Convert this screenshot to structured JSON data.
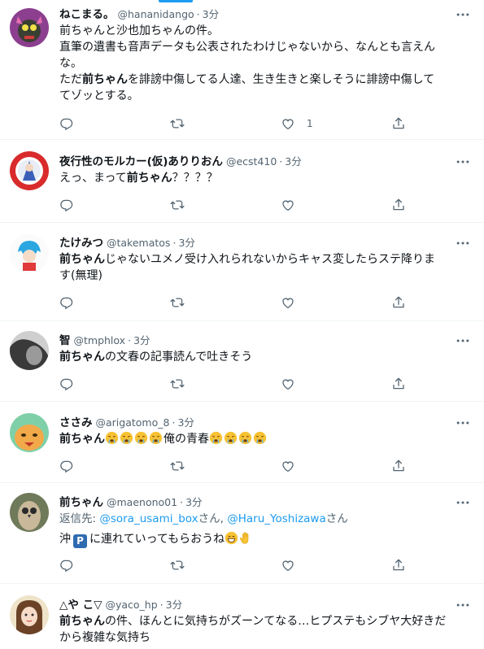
{
  "tweets": [
    {
      "name": "ねこまる。",
      "handle": "@hananidango",
      "sep": "·",
      "time": "3分",
      "text_lines": [
        "前ちゃんと沙也加ちゃんの件。",
        "直筆の遺書も音声データも公表されたわけじゃないから、なんとも言えん",
        "な。",
        "ただ前ちゃんを誹謗中傷してる人達、生き生きと楽しそうに誹謗中傷して",
        "てゾッとする。"
      ],
      "text_pre": "前ちゃんと沙也加ちゃんの件。\n直筆の遺書も音声データも公表されたわけじゃないから、なんとも言えん\nな。\nただ",
      "text_bold": "前ちゃん",
      "text_post": "を誹謗中傷してる人達、生き生きと楽しそうに誹謗中傷して\nてゾッとする。",
      "like_count": "1"
    },
    {
      "name": "夜行性のモルカー(仮)ありりおん",
      "handle": "@ecst410",
      "sep": "·",
      "time": "3分",
      "text_pre": "えっ、まって",
      "text_bold": "前ちゃん",
      "text_post": "？？？？"
    },
    {
      "name": "たけみつ",
      "handle": "@takematos",
      "sep": "·",
      "time": "3分",
      "text_bold": "前ちゃん",
      "text_post": "じゃないユメノ受け入れられないからキャス変したらステ降りま\nす(無理)"
    },
    {
      "name": "智",
      "handle": "@tmphlox",
      "sep": "·",
      "time": "3分",
      "text_bold": "前ちゃん",
      "text_post": "の文春の記事読んで吐きそう"
    },
    {
      "name": "ささみ",
      "handle": "@arigatomo_8",
      "sep": "·",
      "time": "3分",
      "text_bold": "前ちゃん",
      "text_mid": "俺の青春"
    },
    {
      "name": "前ちゃん",
      "handle": "@maenono01",
      "sep": "·",
      "time": "3分",
      "reply_label": "返信先: ",
      "reply_user1": "@sora_usami_box",
      "reply_san1": "さん, ",
      "reply_user2": "@Haru_Yoshizawa",
      "reply_san2": "さん",
      "text_pre": "沖",
      "text_p": "P",
      "text_post": "に連れていってもらおうね"
    },
    {
      "name": "△や こ▽",
      "handle": "@yaco_hp",
      "sep": "·",
      "time": "3分",
      "text_bold": "前ちゃん",
      "text_post": "の件、ほんとに気持ちがズーンてなる…ヒプステもシブヤ大好きだ\nから複雑な気持ち"
    }
  ],
  "colors": {
    "accent": "#1d9bf0",
    "secondary_text": "#536471",
    "divider": "#eff3f4"
  },
  "icons": [
    "reply-icon",
    "retweet-icon",
    "like-icon",
    "share-icon",
    "more-icon"
  ]
}
